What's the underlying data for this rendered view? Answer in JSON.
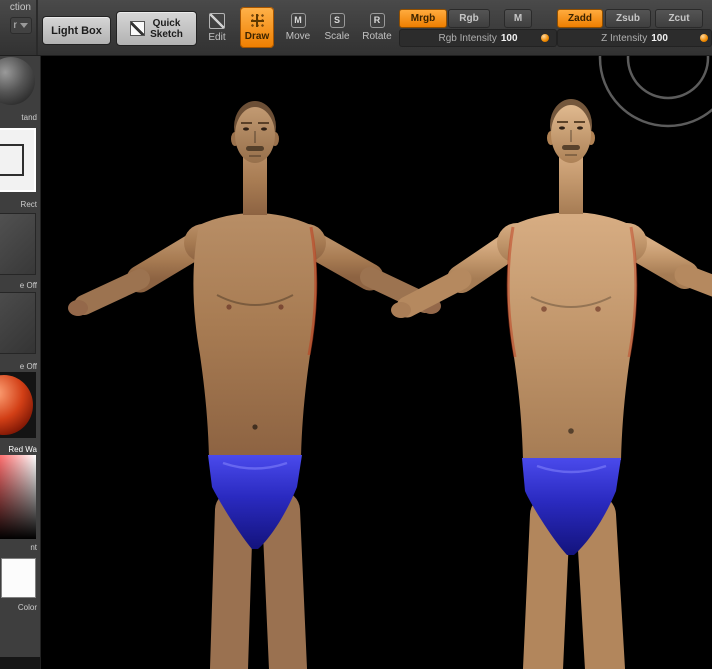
{
  "toolbar": {
    "partial_top": "ction",
    "partial_bottom": "r",
    "light_box": "Light Box",
    "quick_sketch_1": "Quick",
    "quick_sketch_2": "Sketch",
    "edit": "Edit",
    "draw": "Draw",
    "move": "Move",
    "move_badge": "M",
    "scale": "Scale",
    "scale_badge": "S",
    "rotate": "Rotate",
    "rotate_badge": "R",
    "mrgb": "Mrgb",
    "rgb": "Rgb",
    "m": "M",
    "rgb_intensity_label": "Rgb Intensity",
    "rgb_intensity_value": "100",
    "zadd": "Zadd",
    "zsub": "Zsub",
    "zcut": "Zcut",
    "z_intensity_label": "Z Intensity",
    "z_intensity_value": "100"
  },
  "sidebar": {
    "brush_label": "tand",
    "stroke_label": "Rect",
    "alpha_label": "e Off",
    "texture_label": "e Off",
    "material_label": "Red Wa",
    "picker_label": "nt",
    "swatch_label": "Color"
  },
  "colors": {
    "accent_orange": "#f08200",
    "toolbar_bg": "#3d3d3d",
    "sidebar_bg": "#3e3e3e",
    "canvas_bg": "#000000",
    "briefs_blue": "#2a2ac0",
    "skin_left_figure": "#aa7e55",
    "skin_right_figure": "#c59a70"
  }
}
